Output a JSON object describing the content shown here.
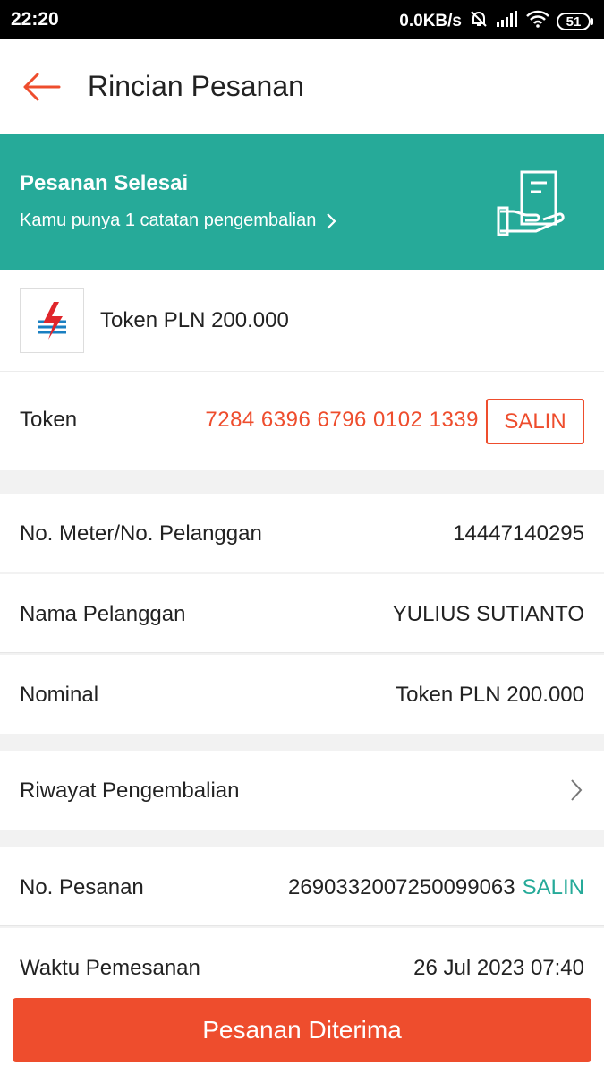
{
  "status_bar": {
    "time": "22:20",
    "network_speed": "0.0KB/s",
    "battery_level": "51",
    "icons": [
      "mute-bell-icon",
      "signal-icon",
      "wifi-icon",
      "battery-icon"
    ]
  },
  "header": {
    "title": "Rincian Pesanan",
    "back_icon": "arrow-left-icon"
  },
  "banner": {
    "title": "Pesanan Selesai",
    "subtitle": "Kamu punya 1 catatan pengembalian",
    "illustration": "receipt-hand-icon",
    "background_color": "#26aa99"
  },
  "product": {
    "name": "Token PLN 200.000",
    "logo": "pln-logo"
  },
  "token": {
    "label": "Token",
    "value": "7284 6396 6796 0102 1339",
    "copy_label": "SALIN"
  },
  "details": [
    {
      "label": "No. Meter/No. Pelanggan",
      "value": "14447140295"
    },
    {
      "label": "Nama Pelanggan",
      "value": "YULIUS SUTIANTO"
    },
    {
      "label": "Nominal",
      "value": "Token PLN 200.000"
    }
  ],
  "refund_history": {
    "label": "Riwayat Pengembalian"
  },
  "order": {
    "number_label": "No. Pesanan",
    "number_value": "2690332007250099063",
    "copy_label": "SALIN",
    "time_label": "Waktu Pemesanan",
    "time_value": "26 Jul 2023 07:40"
  },
  "footer": {
    "button_label": "Pesanan Diterima"
  },
  "colors": {
    "accent": "#ee4d2d",
    "teal": "#26aa99"
  }
}
